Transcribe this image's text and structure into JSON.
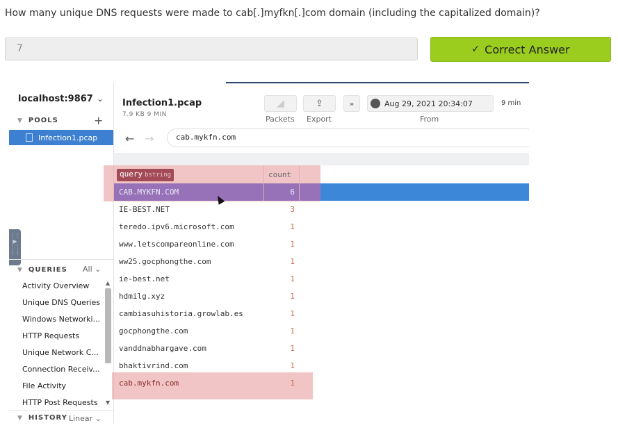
{
  "question": "How many unique DNS requests were made to cab[.]myfkn[.]com domain (including the capitalized domain)?",
  "answer_value": "7",
  "correct_label": "Correct Answer",
  "sidebar": {
    "host": "localhost:9867",
    "pools_label": "POOLS",
    "pool_item": "Infection1.pcap",
    "queries_label": "QUERIES",
    "queries_filter": "All",
    "queries": [
      "Activity Overview",
      "Unique DNS Queries",
      "Windows Networki...",
      "HTTP Requests",
      "Unique Network C...",
      "Connection Receiv...",
      "File Activity",
      "HTTP Post Requests"
    ],
    "history_label": "HISTORY",
    "history_mode": "Linear"
  },
  "header": {
    "file_title": "Infection1.pcap",
    "file_meta": "7.9 KB   9 MIN",
    "packets_label": "Packets",
    "export_label": "Export",
    "from_label": "From",
    "time_value": "Aug 29, 2021 20:34:07",
    "duration": "9 min",
    "search_value": "cab.mykfn.com"
  },
  "table": {
    "col_query": "query",
    "col_query_type": "bstring",
    "col_count": "count",
    "rows": [
      {
        "query": "CAB.MYKFN.COM",
        "count": "6"
      },
      {
        "query": "IE-BEST.NET",
        "count": "3"
      },
      {
        "query": "teredo.ipv6.microsoft.com",
        "count": "1"
      },
      {
        "query": "www.letscompareonline.com",
        "count": "1"
      },
      {
        "query": "ww25.gocphongthe.com",
        "count": "1"
      },
      {
        "query": "ie-best.net",
        "count": "1"
      },
      {
        "query": "hdmilg.xyz",
        "count": "1"
      },
      {
        "query": "cambiasuhistoria.growlab.es",
        "count": "1"
      },
      {
        "query": "gocphongthe.com",
        "count": "1"
      },
      {
        "query": "vanddnabhargave.com",
        "count": "1"
      },
      {
        "query": "bhaktivrind.com",
        "count": "1"
      },
      {
        "query": "cab.mykfn.com",
        "count": "1"
      }
    ]
  },
  "colors": {
    "accent_green": "#9acd1e",
    "selection_blue": "#3d87d8",
    "highlight_red": "#e69696",
    "count_orange": "#d06a4a"
  }
}
